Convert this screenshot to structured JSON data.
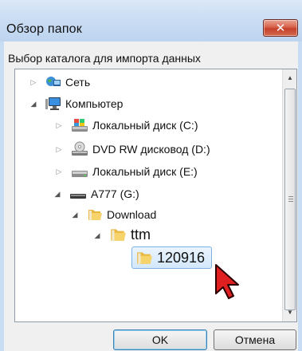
{
  "window": {
    "title": "Обзор папок",
    "prompt": "Выбор каталога для импорта данных",
    "close_glyph": "✕"
  },
  "tree": {
    "items": [
      {
        "label": "Сеть",
        "icon": "network-icon",
        "state": "collapsed"
      },
      {
        "label": "Компьютер",
        "icon": "computer-icon",
        "state": "expanded"
      },
      {
        "label": "Локальный диск (C:)",
        "icon": "system-drive-icon",
        "state": "collapsed"
      },
      {
        "label": "DVD RW дисковод (D:)",
        "icon": "dvd-drive-icon",
        "state": "collapsed"
      },
      {
        "label": "Локальный диск (E:)",
        "icon": "drive-icon",
        "state": "collapsed"
      },
      {
        "label": "A777 (G:)",
        "icon": "removable-drive-icon",
        "state": "expanded"
      },
      {
        "label": "Download",
        "icon": "folder-icon",
        "state": "expanded"
      },
      {
        "label": "ttm",
        "icon": "folder-icon",
        "state": "expanded"
      },
      {
        "label": "120916",
        "icon": "folder-icon",
        "state": "selected"
      }
    ]
  },
  "buttons": {
    "ok": "OK",
    "cancel": "Отмена"
  },
  "colors": {
    "selection_border": "#7fb0e0",
    "close_button": "#c4402a",
    "folder": "#f2c24f"
  }
}
